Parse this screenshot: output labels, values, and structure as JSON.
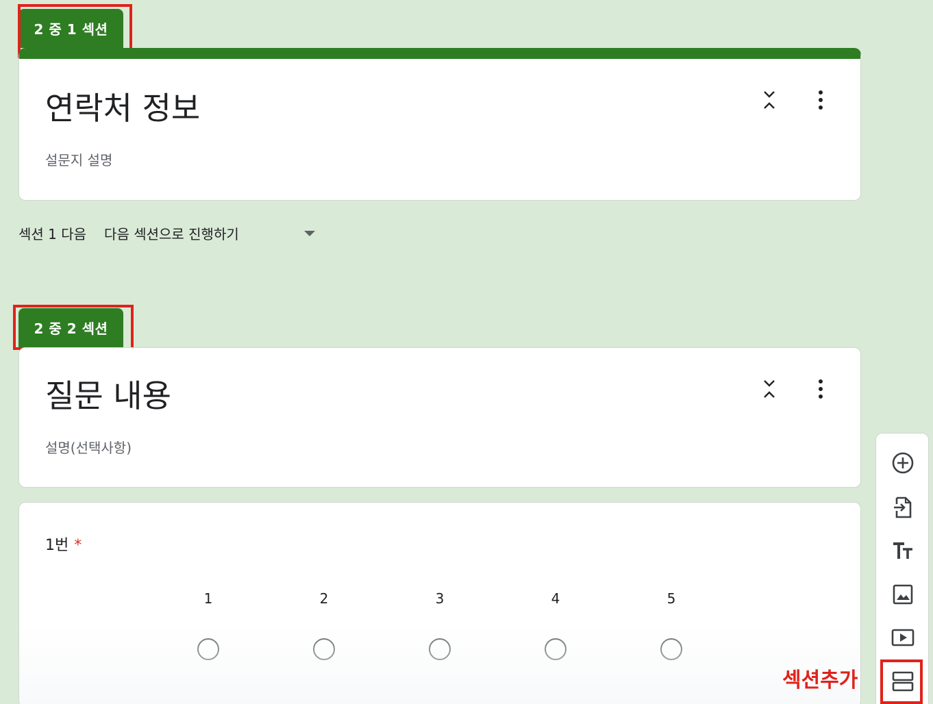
{
  "sections": [
    {
      "tab_label": "2 중 1 섹션",
      "title": "연락처 정보",
      "description": "설문지 설명"
    },
    {
      "tab_label": "2 중 2 섹션",
      "title": "질문 내용",
      "description": "설명(선택사항)"
    }
  ],
  "after_section": {
    "label": "섹션 1 다음",
    "selected_option": "다음 섹션으로 진행하기"
  },
  "question": {
    "title": "1번",
    "required_mark": "*",
    "scale": [
      "1",
      "2",
      "3",
      "4",
      "5"
    ]
  },
  "toolbar": {
    "icons": [
      "add-question-icon",
      "import-questions-icon",
      "add-title-icon",
      "add-image-icon",
      "add-video-icon",
      "add-section-icon"
    ]
  },
  "annotation": {
    "add_section_note": "섹션추가"
  },
  "colors": {
    "background": "#d9ead7",
    "theme_green": "#2e7d23",
    "highlight_red": "#e0221b"
  }
}
